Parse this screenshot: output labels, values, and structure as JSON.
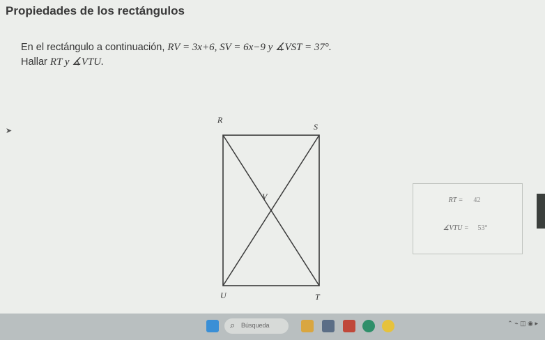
{
  "header": {
    "title": "Propiedades de los rectángulos"
  },
  "problem": {
    "line1_text": "En el rectángulo a continuación, ",
    "line1_math": "RV = 3x+6, SV = 6x−9 y ∡VST = 37°.",
    "line2_text": "Hallar ",
    "line2_math": "RT y ∡VTU."
  },
  "figure": {
    "labels": {
      "r": "R",
      "s": "S",
      "u": "U",
      "t": "T",
      "v": "V"
    }
  },
  "answers": {
    "rt_label": "RT =",
    "rt_value": "42",
    "angle_label": "∡VTU =",
    "angle_value": "53°"
  },
  "taskbar": {
    "search_placeholder": "Búsqueda",
    "colors": {
      "start": "#3a8fd6",
      "bar": "#b9bfc0"
    }
  }
}
